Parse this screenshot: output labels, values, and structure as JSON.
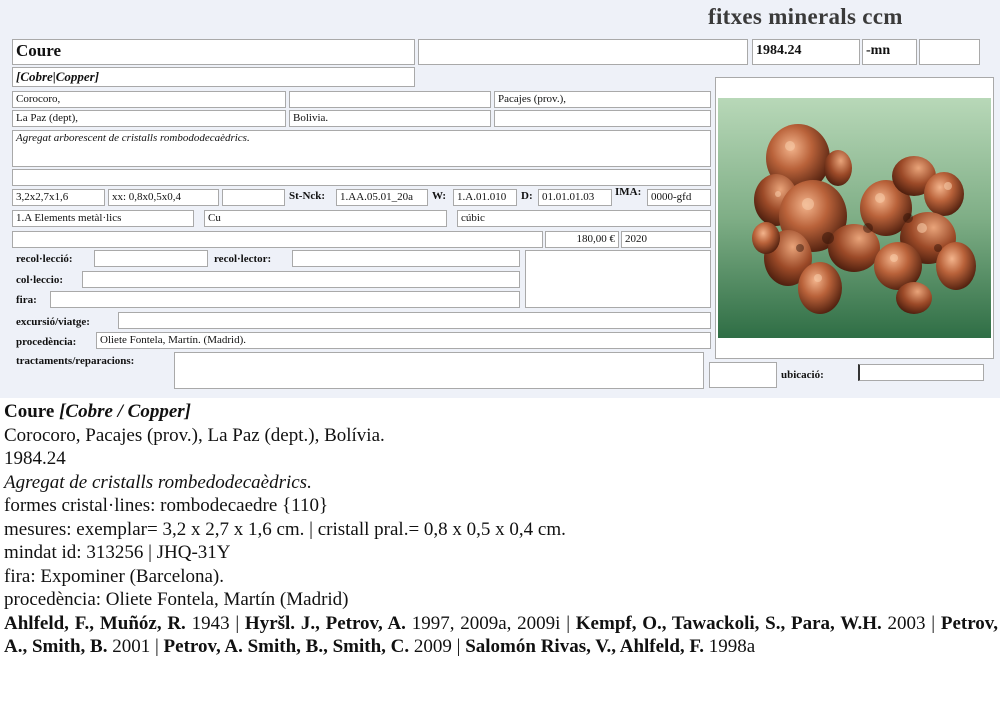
{
  "brand": "fitxes minerals ccm",
  "card": {
    "name": "Coure",
    "synonyms": "[Cobre|Copper]",
    "locality": "Corocoro,",
    "province": "Pacajes (prov.),",
    "department": "La Paz (dept),",
    "country": "Bolivia.",
    "catalog_number": "1984.24",
    "catalog_suffix": "-mn",
    "description": "Agregat arborescent de cristalls rombododecaèdrics.",
    "size_specimen": "3,2x2,7x1,6",
    "size_crystal": "xx: 0,8x0,5x0,4",
    "st_nck_label": "St-Nck:",
    "st_nck_value": "1.AA.05.01_20a",
    "w_label": "W:",
    "w_value": "1.A.01.010",
    "d_label": "D:",
    "d_value": "01.01.01.03",
    "ima_label": "IMA:",
    "ima_value": "0000-gfd",
    "class": "1.A Elements metàl·lics",
    "formula": "Cu",
    "crystal_system": "cúbic",
    "price": "180,00 €",
    "year": "2020",
    "labels": {
      "recolleccio": "recol·lecció:",
      "recollector": "recol·lector:",
      "colleccio": "col·leccio:",
      "fira": "fira:",
      "excursio": "excursió/viatge:",
      "procedencia": "procedència:",
      "tractaments": "tractaments/reparacions:",
      "ubicacio": "ubicació:"
    },
    "procedencia_value": "Oliete Fontela, Martín. (Madrid)."
  },
  "summary": {
    "title_name": "Coure",
    "title_syn": "[Cobre / Copper]",
    "locality_line": "Corocoro, Pacajes (prov.), La Paz (dept.), Bolívia.",
    "number_line": "1984.24",
    "description_line": "Agregat de cristalls rombedodecaèdrics.",
    "forms_line": "formes cristal·lines: rombodecaedre {110}",
    "measures_line": "mesures: exemplar= 3,2 x 2,7 x 1,6 cm. | cristall pral.=  0,8 x 0,5 x 0,4 cm.",
    "mindat_line": "mindat id: 313256 | JHQ-31Y",
    "fira_line": "fira: Expominer (Barcelona).",
    "procedencia_line": "procedència: Oliete Fontela, Martín (Madrid)",
    "refs": [
      {
        "authors": "Ahlfeld, F., Muñóz, R.",
        "years": " 1943 | "
      },
      {
        "authors": "Hyršl. J., Petrov, A.",
        "years": " 1997, 2009a, 2009i | "
      },
      {
        "authors": "Kempf, O., Tawackoli, S., Para, W.H.",
        "years": " 2003 | "
      },
      {
        "authors": "Petrov, A., Smith, B.",
        "years": " 2001 | "
      },
      {
        "authors": "Petrov, A. Smith, B., Smith, C.",
        "years": " 2009 | "
      },
      {
        "authors": "Salomón Rivas, V., Ahlfeld, F.",
        "years": " 1998a"
      }
    ]
  }
}
